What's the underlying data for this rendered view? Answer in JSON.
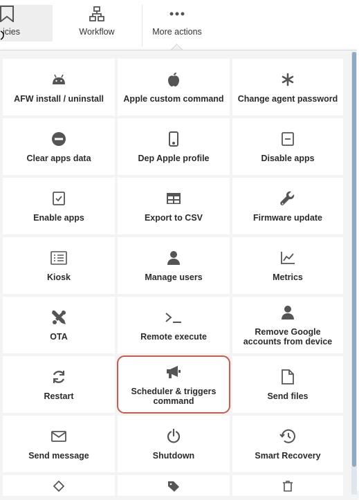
{
  "toolbar": {
    "policies_label": "icies",
    "workflow_label": "Workflow",
    "more_label": "More actions"
  },
  "actions": [
    {
      "label": "AFW install / uninstall",
      "icon": "android-icon"
    },
    {
      "label": "Apple custom command",
      "icon": "apple-icon"
    },
    {
      "label": "Change agent password",
      "icon": "asterisk-icon"
    },
    {
      "label": "Clear apps data",
      "icon": "minus-circle-icon"
    },
    {
      "label": "Dep Apple profile",
      "icon": "mobile-icon"
    },
    {
      "label": "Disable apps",
      "icon": "minus-square-icon"
    },
    {
      "label": "Enable apps",
      "icon": "check-square-icon"
    },
    {
      "label": "Export to CSV",
      "icon": "table-icon"
    },
    {
      "label": "Firmware update",
      "icon": "wrench-icon"
    },
    {
      "label": "Kiosk",
      "icon": "list-icon"
    },
    {
      "label": "Manage users",
      "icon": "user-icon"
    },
    {
      "label": "Metrics",
      "icon": "line-chart-icon"
    },
    {
      "label": "OTA",
      "icon": "tools-icon"
    },
    {
      "label": "Remote execute",
      "icon": "terminal-icon"
    },
    {
      "label": "Remove Google accounts from device",
      "icon": "user-icon"
    },
    {
      "label": "Restart",
      "icon": "refresh-icon"
    },
    {
      "label": "Scheduler & triggers command",
      "icon": "megaphone-icon"
    },
    {
      "label": "Send files",
      "icon": "file-icon"
    },
    {
      "label": "Send message",
      "icon": "envelope-icon"
    },
    {
      "label": "Shutdown",
      "icon": "power-icon"
    },
    {
      "label": "Smart Recovery",
      "icon": "history-icon"
    }
  ],
  "partial_row_icons": [
    "diamond-icon",
    "tag-icon",
    "trash-icon"
  ],
  "colors": {
    "highlight": "#cf5a4a",
    "icon": "#555555",
    "panel_bg": "#f4f4f4",
    "scroll_thumb": "#8fa9c5"
  }
}
